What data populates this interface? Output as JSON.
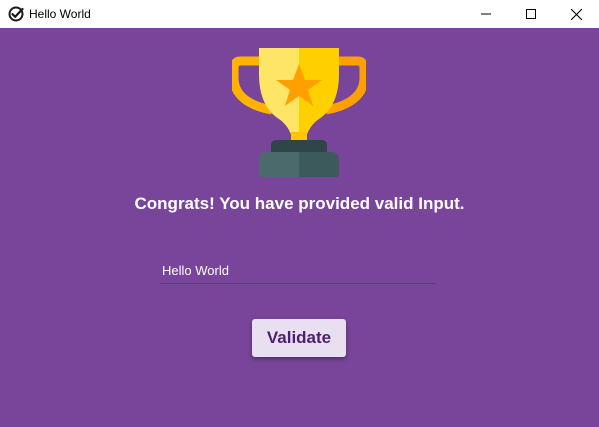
{
  "window": {
    "title": "Hello World",
    "controls": {
      "minimize_icon": "minimize-icon",
      "maximize_icon": "maximize-icon",
      "close_icon": "close-icon"
    }
  },
  "main": {
    "trophy_icon": "trophy-icon",
    "headline": "Congrats! You have provided valid Input.",
    "input": {
      "value": "Hello World",
      "placeholder": ""
    },
    "validate_label": "Validate"
  },
  "colors": {
    "background": "#78459a",
    "button_bg": "#e8dff0",
    "button_text": "#4d1f72",
    "trophy_gold": "#ffd700",
    "trophy_orange": "#ffa500",
    "trophy_base": "#3f5d5f"
  }
}
